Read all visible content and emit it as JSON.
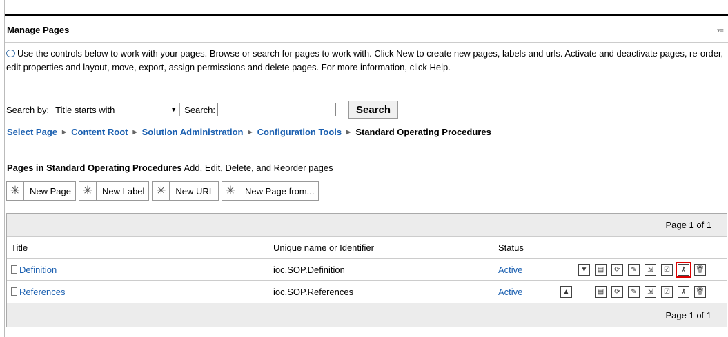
{
  "portlet": {
    "title": "Manage Pages",
    "menu_icon": "portlet-menu-icon"
  },
  "description": "Use the controls below to work with your pages. Browse or search for pages to work with. Click New to create new pages, labels and urls. Activate and deactivate pages, re-order, edit properties and layout, move, export, assign permissions and delete pages. For more information, click Help.",
  "search": {
    "by_label": "Search by:",
    "by_value": "Title starts with",
    "search_label": "Search:",
    "input_value": "",
    "button": "Search"
  },
  "breadcrumb": [
    "Select Page",
    "Content Root",
    "Solution Administration",
    "Configuration Tools"
  ],
  "breadcrumb_current": "Standard Operating Procedures",
  "pages_in": {
    "prefix": "Pages in",
    "name": "Standard Operating Procedures",
    "suffix": "Add, Edit, Delete, and Reorder pages"
  },
  "new_buttons": [
    "New Page",
    "New Label",
    "New URL",
    "New Page from..."
  ],
  "table": {
    "pager_top": "Page 1 of 1",
    "pager_bottom": "Page 1 of 1",
    "headers": [
      "Title",
      "Unique name or Identifier",
      "Status"
    ],
    "rows": [
      {
        "title": "Definition",
        "id": "ioc.SOP.Definition",
        "status": "Active"
      },
      {
        "title": "References",
        "id": "ioc.SOP.References",
        "status": "Active"
      }
    ]
  },
  "colors": {
    "link": "#1a5fb0",
    "highlight": "#dd0000"
  }
}
